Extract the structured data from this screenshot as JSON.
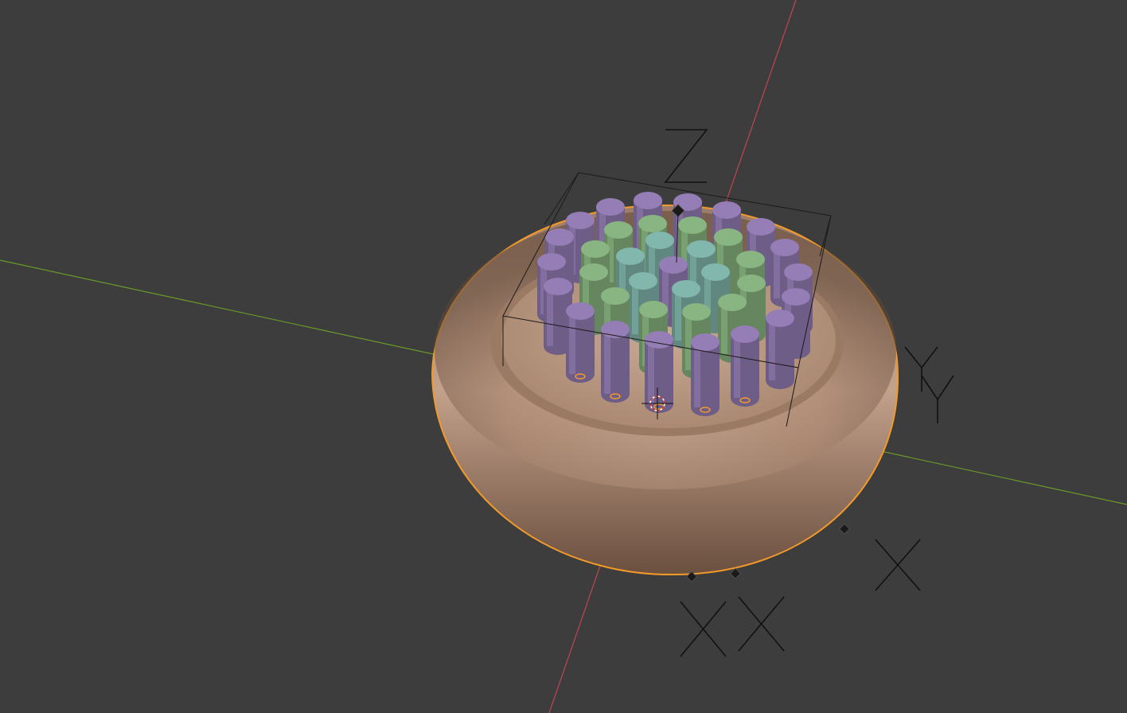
{
  "viewport": {
    "background": "#3d3d3d",
    "x_axis_color": "#c0474f",
    "y_axis_color": "#6a9a2a",
    "selection_outline_color": "#f39a2a"
  },
  "objects": {
    "base_color": "#b99580",
    "cylinder_colors": {
      "purple": "#8a74a8",
      "green": "#7ea877",
      "teal": "#78a9a0"
    }
  },
  "empties": {
    "z_label": "Z",
    "y_label_1": "Y",
    "y_label_2": "Y",
    "x_label_1": "X",
    "x_label_2": "X",
    "x_label_3": "X"
  },
  "icons": {
    "cursor": "3d-cursor-icon",
    "origin": "object-origin-icon"
  }
}
